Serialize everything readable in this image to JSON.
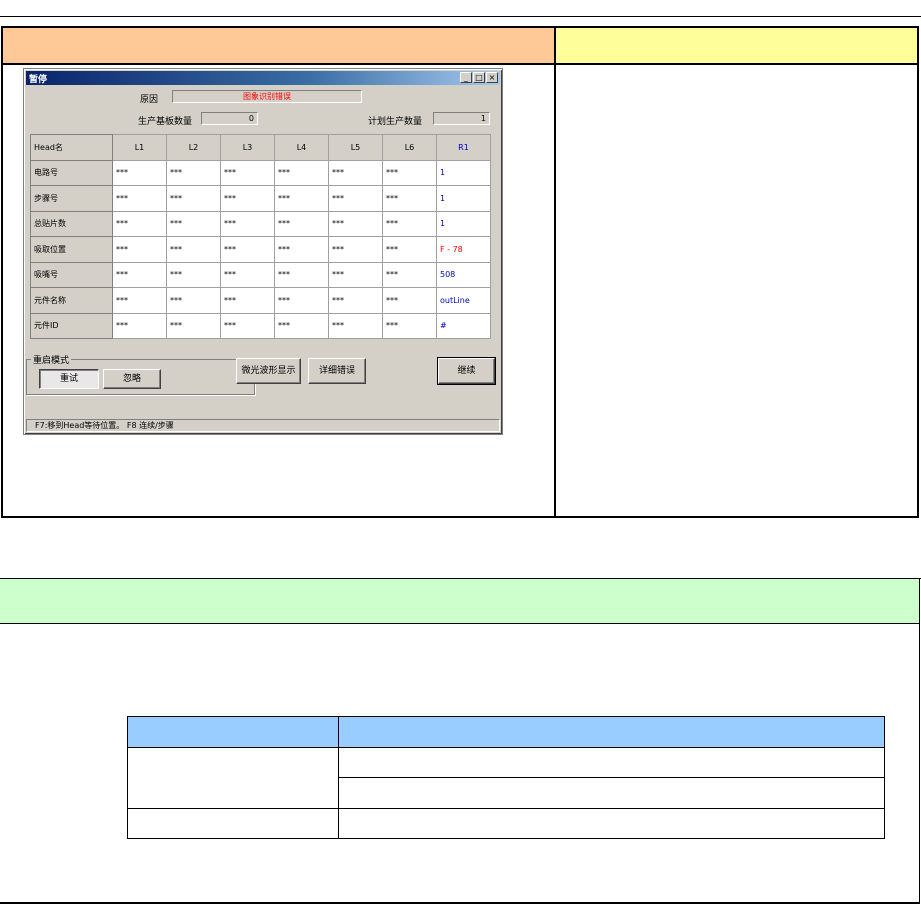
{
  "dialog": {
    "title": "暂停",
    "controls": {
      "minimize": "_",
      "maximize": "□",
      "close": "×"
    },
    "reason_label": "原因",
    "reason_value": "图象识别错误",
    "produced_count_label": "生产基板数量",
    "produced_count_value": "0",
    "planned_count_label": "计划生产数量",
    "planned_count_value": "1",
    "table": {
      "corner": "Head名",
      "columns": [
        "L1",
        "L2",
        "L3",
        "L4",
        "L5",
        "L6",
        "R1"
      ],
      "rows": [
        {
          "label": "电路号",
          "cells": [
            "***",
            "***",
            "***",
            "***",
            "***",
            "***",
            "1"
          ]
        },
        {
          "label": "步骤号",
          "cells": [
            "***",
            "***",
            "***",
            "***",
            "***",
            "***",
            "1"
          ]
        },
        {
          "label": "总贴片数",
          "cells": [
            "***",
            "***",
            "***",
            "***",
            "***",
            "***",
            "1"
          ]
        },
        {
          "label": "吸取位置",
          "cells": [
            "***",
            "***",
            "***",
            "***",
            "***",
            "***",
            "F - 78"
          ]
        },
        {
          "label": "吸嘴号",
          "cells": [
            "***",
            "***",
            "***",
            "***",
            "***",
            "***",
            "508"
          ]
        },
        {
          "label": "元件名称",
          "cells": [
            "***",
            "***",
            "***",
            "***",
            "***",
            "***",
            "outLine"
          ]
        },
        {
          "label": "元件ID",
          "cells": [
            "***",
            "***",
            "***",
            "***",
            "***",
            "***",
            "#"
          ]
        }
      ]
    },
    "restart_mode_label": "重启模式",
    "retry_button": "重试",
    "skip_button": "忽略",
    "show_shape_button": "微光波形显示",
    "detail_error_button": "详细错误",
    "continue_button": "继续",
    "status_text": "F7:移到Head等待位置。  F8 连续/步骤",
    "colors": {
      "title_start": "#0a246a",
      "face": "#d4d0c8",
      "accent_blue": "#0000c0",
      "error_red": "#ff0000"
    }
  },
  "sections": {
    "upper_left_header_color": "#fec997",
    "upper_right_header_color": "#fefe9a",
    "lower_header_color": "#ccffcc",
    "table_header_color": "#99ccff"
  }
}
